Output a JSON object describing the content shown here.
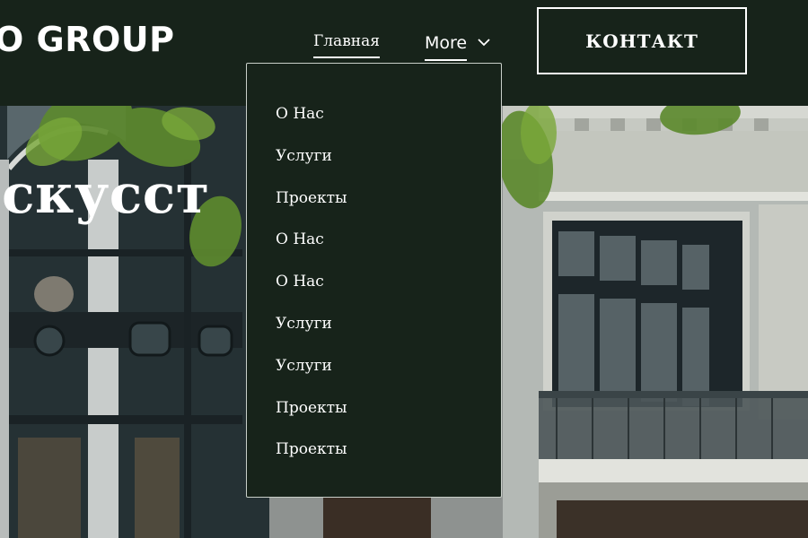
{
  "header": {
    "logo": "O GROUP",
    "nav": {
      "home_label": "Главная",
      "more_label": "More"
    },
    "contact_label": "КОНТАКТ"
  },
  "hero": {
    "title": "скусст"
  },
  "dropdown": {
    "items": [
      {
        "label": "О Нас"
      },
      {
        "label": "Услуги"
      },
      {
        "label": "Проекты"
      },
      {
        "label": "О Нас"
      },
      {
        "label": "О Нас"
      },
      {
        "label": "Услуги"
      },
      {
        "label": "Услуги"
      },
      {
        "label": "Проекты"
      },
      {
        "label": "Проекты"
      }
    ]
  },
  "colors": {
    "background": "#17231a",
    "text": "#ffffff",
    "dropdown_border": "#c9cfc9"
  },
  "icons": {
    "more_chevron": "chevron-down-icon"
  }
}
